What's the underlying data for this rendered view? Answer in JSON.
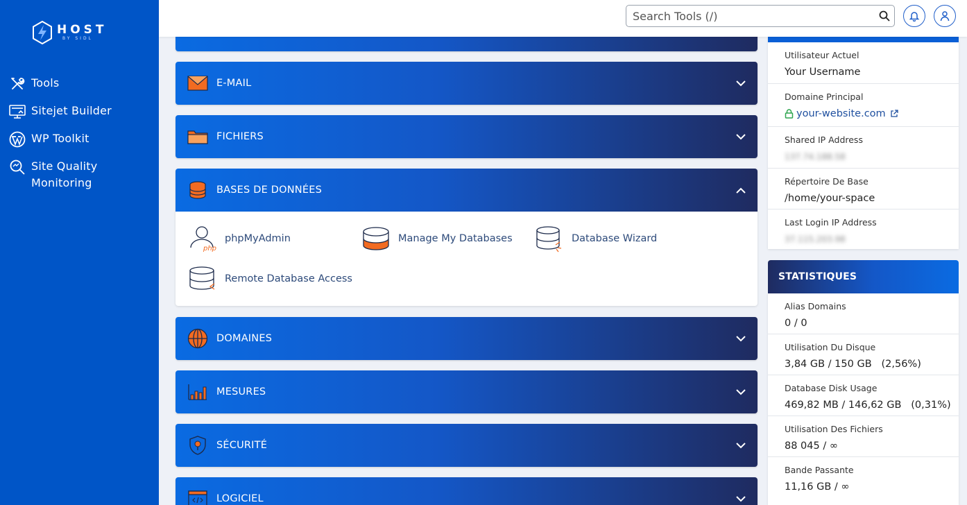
{
  "brand": {
    "name": "HOST",
    "sub": "BY SIDL"
  },
  "sidebar": {
    "items": [
      {
        "label": "Tools",
        "icon": "tools-icon"
      },
      {
        "label": "Sitejet Builder",
        "icon": "monitor-icon"
      },
      {
        "label": "WP Toolkit",
        "icon": "wordpress-icon"
      },
      {
        "label": "Site Quality Monitoring",
        "line1": "Site Quality",
        "line2": "Monitoring",
        "icon": "magnifier-chart-icon"
      }
    ]
  },
  "topbar": {
    "search_placeholder": "Search Tools (/)",
    "notifications": "bell-icon",
    "user": "user-icon"
  },
  "panels": [
    {
      "title": "E-MAIL",
      "icon": "envelope-icon",
      "expanded": false
    },
    {
      "title": "FICHIERS",
      "icon": "folder-icon",
      "expanded": false
    },
    {
      "title": "BASES DE DONNÉES",
      "icon": "database-icon",
      "expanded": true
    },
    {
      "title": "DOMAINES",
      "icon": "globe-icon",
      "expanded": false
    },
    {
      "title": "MESURES",
      "icon": "bar-chart-icon",
      "expanded": false
    },
    {
      "title": "SÉCURITÉ",
      "icon": "shield-icon",
      "expanded": false
    },
    {
      "title": "LOGICIEL",
      "icon": "code-window-icon",
      "expanded": false
    }
  ],
  "database_tools": [
    {
      "label": "phpMyAdmin",
      "icon": "phpmyadmin-icon"
    },
    {
      "label": "Manage My Databases",
      "icon": "manage-databases-icon"
    },
    {
      "label": "Database Wizard",
      "icon": "database-wizard-icon"
    },
    {
      "label": "Remote Database Access",
      "icon": "remote-database-icon"
    }
  ],
  "info": {
    "current_user_label": "Utilisateur Actuel",
    "current_user": "Your Username",
    "main_domain_label": "Domaine Principal",
    "main_domain": "your-website.com",
    "shared_ip_label": "Shared IP Address",
    "shared_ip": "137.74.188.58",
    "home_dir_label": "Répertoire De Base",
    "home_dir": "/home/your-space",
    "last_login_label": "Last Login IP Address",
    "last_login": "37.115.203.98"
  },
  "stats": {
    "title": "STATISTIQUES",
    "rows": [
      {
        "label": "Alias Domains",
        "value": "0 / 0"
      },
      {
        "label": "Utilisation Du Disque",
        "value": "3,84 GB / 150 GB   (2,56%)"
      },
      {
        "label": "Database Disk Usage",
        "value": "469,82 MB / 146,62 GB   (0,31%)"
      },
      {
        "label": "Utilisation Des Fichiers",
        "value": "88 045 / ∞"
      },
      {
        "label": "Bande Passante",
        "value": "11,16 GB / ∞"
      }
    ]
  },
  "colors": {
    "sidebar": "#0055c7",
    "accent": "#0a6be2",
    "dark": "#1f2b60",
    "orange": "#f26b21"
  }
}
